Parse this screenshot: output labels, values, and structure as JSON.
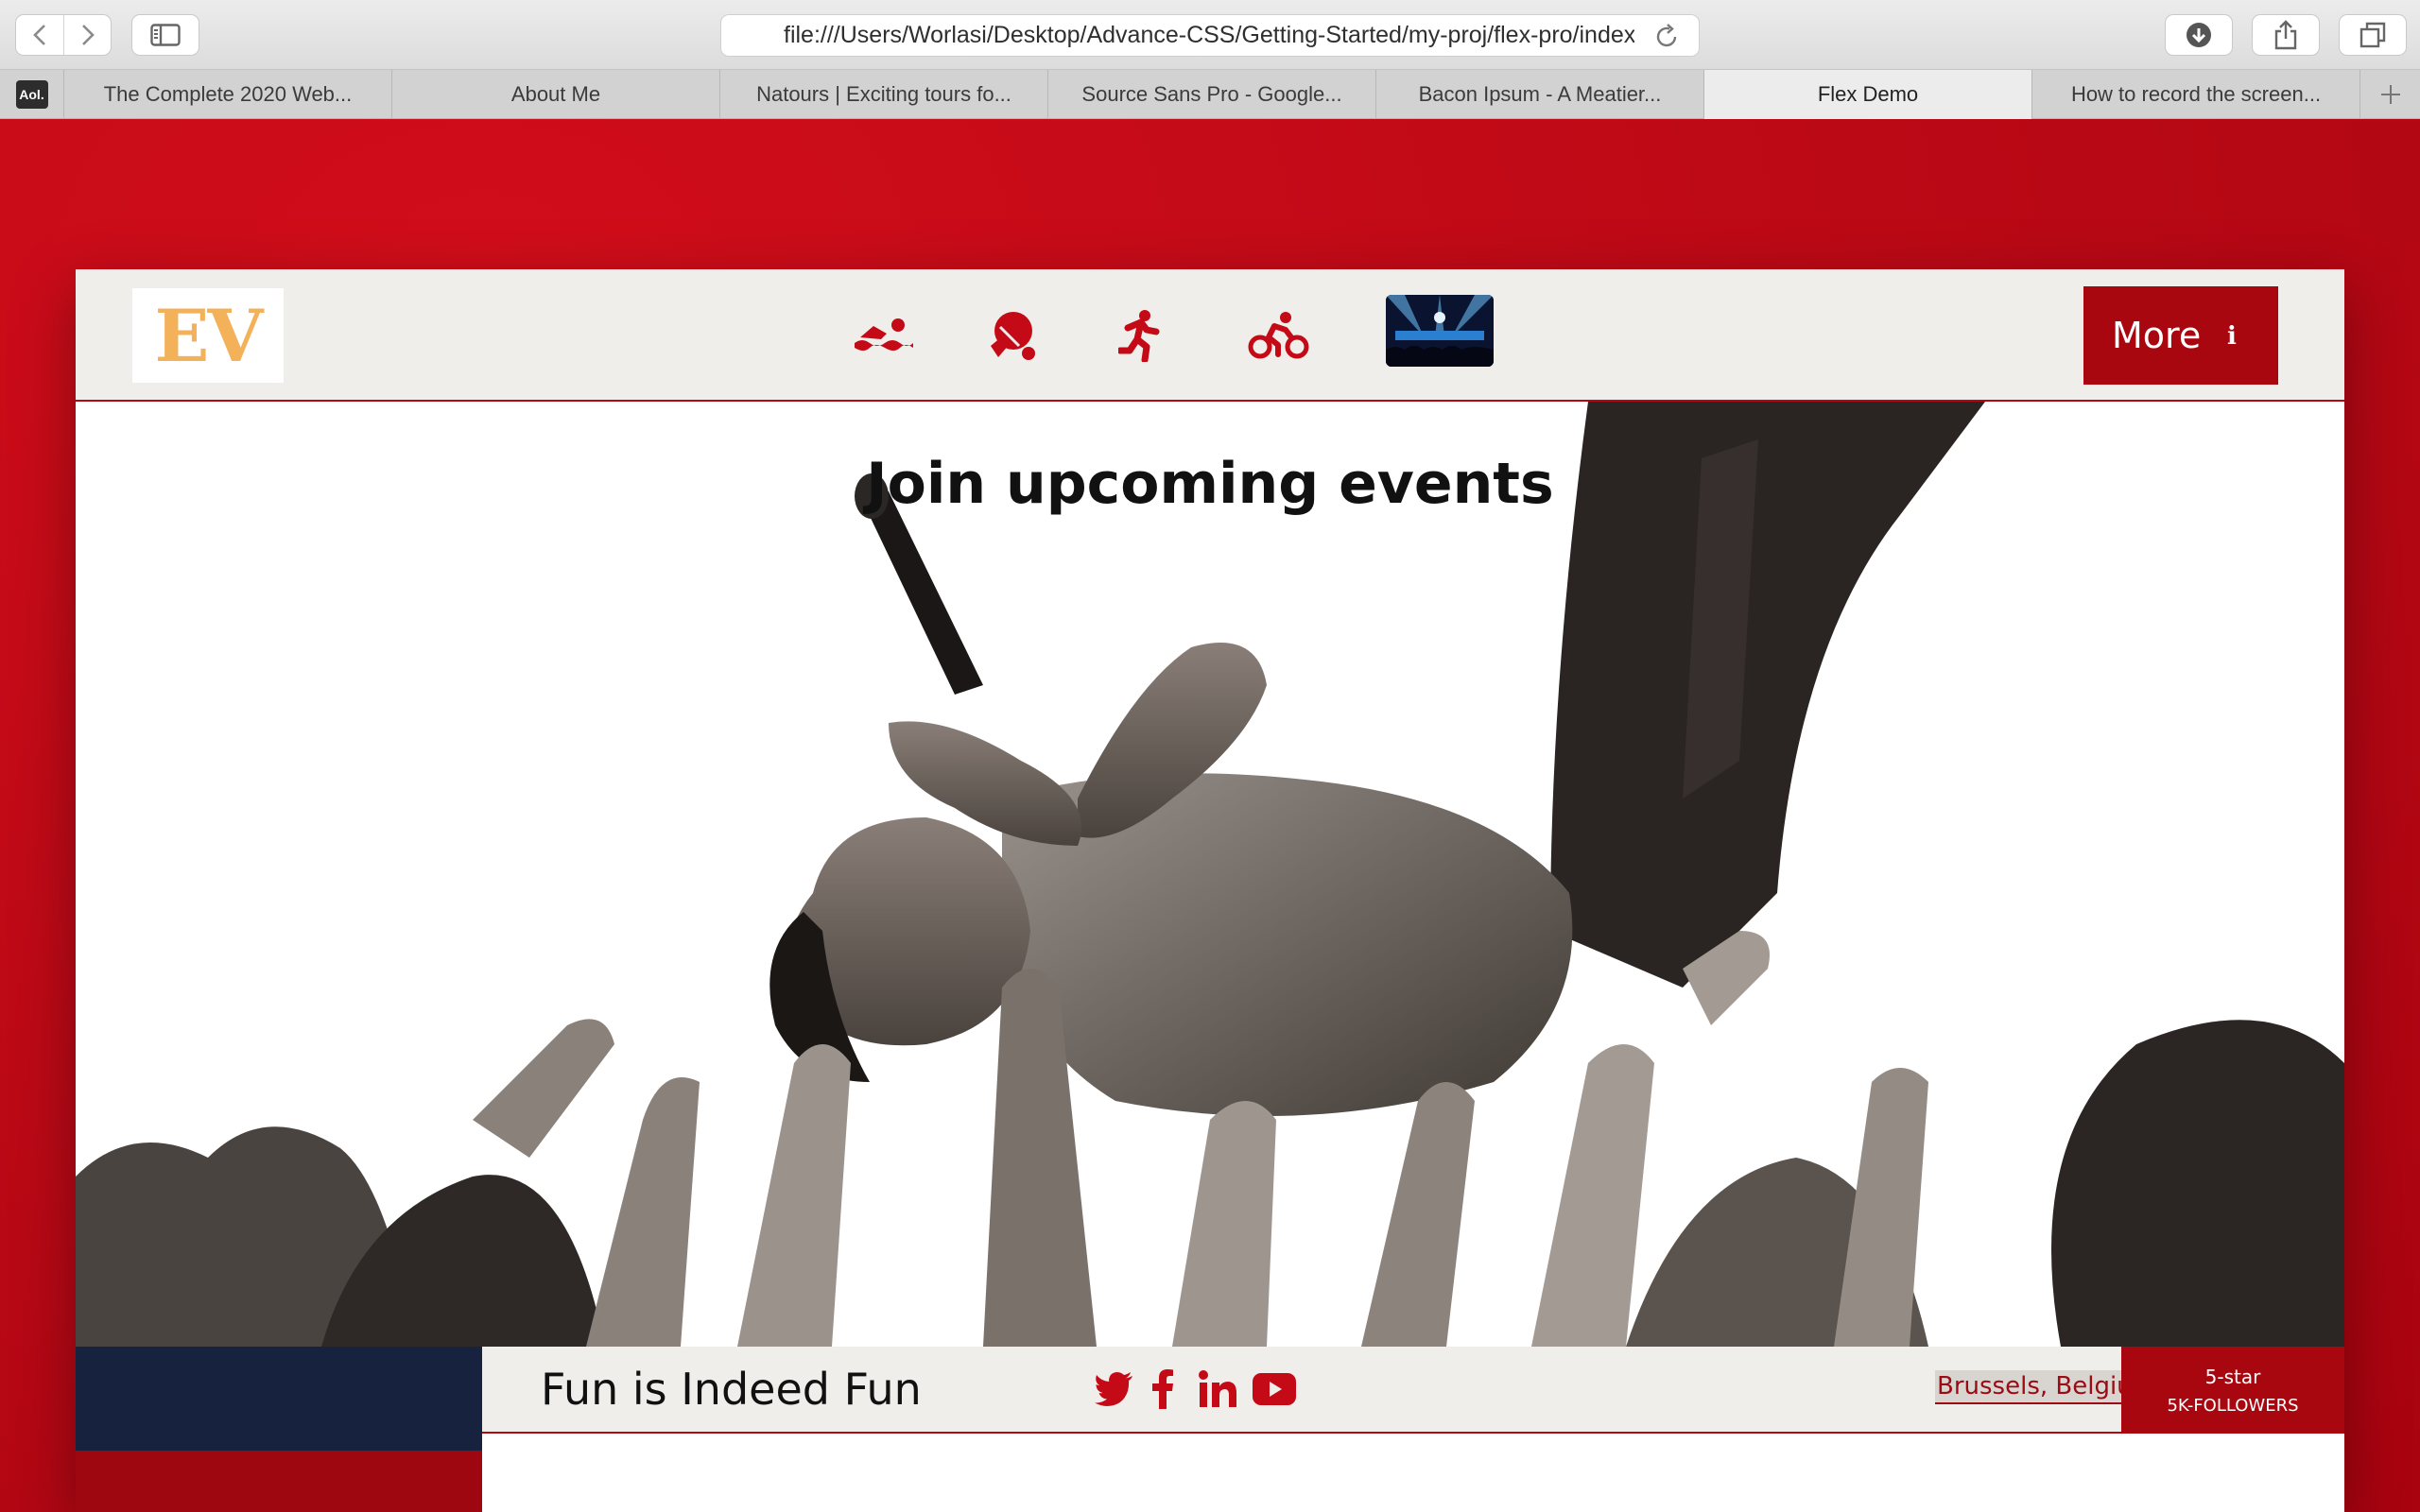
{
  "browser": {
    "url": "file:///Users/Worlasi/Desktop/Advance-CSS/Getting-Started/my-proj/flex-pro/index.html",
    "tabs": [
      {
        "label": "The Complete 2020 Web...",
        "active": false
      },
      {
        "label": "About Me",
        "active": false
      },
      {
        "label": "Natours | Exciting tours fo...",
        "active": false
      },
      {
        "label": "Source Sans Pro - Google...",
        "active": false
      },
      {
        "label": "Bacon Ipsum - A Meatier...",
        "active": false
      },
      {
        "label": "Flex Demo",
        "active": true
      },
      {
        "label": "How to record the screen...",
        "active": false
      }
    ],
    "pinned_tab": "Aol."
  },
  "header": {
    "logo": "EV",
    "nav_icons": [
      "swimming-icon",
      "table-tennis-icon",
      "running-icon",
      "cycling-icon",
      "concert-photo"
    ],
    "more_label": "More",
    "more_icon": "i"
  },
  "hero": {
    "title": "Join upcoming events"
  },
  "footer": {
    "tagline": "Fun is Indeed Fun",
    "social_icons": [
      "twitter-icon",
      "facebook-icon",
      "linkedin-icon",
      "youtube-icon"
    ],
    "location": "Brussels, Belgium",
    "rating": "5-star",
    "followers": "5K-FOLLOWERS"
  },
  "colors": {
    "brand_red": "#a80710",
    "page_red": "#c50a17",
    "navy": "#17233e",
    "logo_gold": "#f3b15a",
    "header_bg": "#efeeea"
  }
}
